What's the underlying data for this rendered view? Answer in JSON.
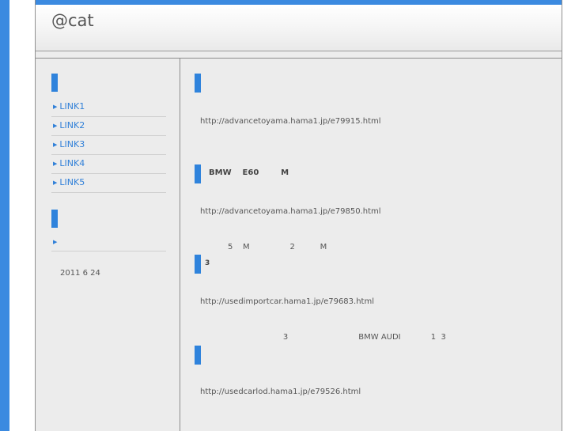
{
  "site": {
    "title": "@cat"
  },
  "sidebar": {
    "links": [
      {
        "label": "LINK1"
      },
      {
        "label": "LINK2"
      },
      {
        "label": "LINK3"
      },
      {
        "label": "LINK4"
      },
      {
        "label": "LINK5"
      }
    ],
    "archive_entry": "",
    "date": "2011 6 24"
  },
  "posts": [
    {
      "title": "",
      "url": "http://advancetoyama.hama1.jp/e79915.html",
      "text": ""
    },
    {
      "title": "BMW    E60        M",
      "url": "http://advancetoyama.hama1.jp/e79850.html",
      "text": "           5    M                2          M"
    },
    {
      "title": "3",
      "url": "http://usedimportcar.hama1.jp/e79683.html",
      "text": "                                 3                            BMW AUDI            1  3"
    },
    {
      "title": "",
      "url": "http://usedcarlod.hama1.jp/e79526.html",
      "text": ""
    }
  ],
  "colors": {
    "accent": "#2f83dc",
    "link": "#2f7fd8",
    "background": "#ececec"
  }
}
